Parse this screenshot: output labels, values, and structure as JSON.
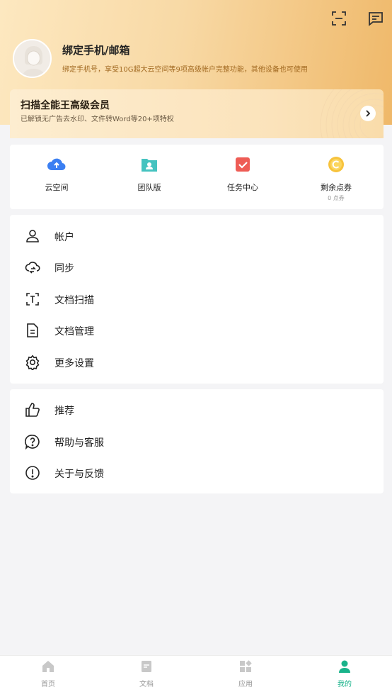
{
  "header": {
    "scan_icon": "scan-frame-icon",
    "message_icon": "message-icon",
    "user_title": "绑定手机/邮箱",
    "user_subtitle": "绑定手机号，享受10G超大云空间等9项高级帐户完整功能，其他设备也可使用"
  },
  "vip_banner": {
    "title": "扫描全能王高级会员",
    "subtitle": "已解锁无广告去水印、文件转Word等20+项特权"
  },
  "quick_actions": [
    {
      "label": "云空间",
      "icon": "cloud-upload-icon"
    },
    {
      "label": "团队版",
      "icon": "team-folder-icon"
    },
    {
      "label": "任务中心",
      "icon": "task-check-icon"
    },
    {
      "label": "剩余点券",
      "sub": "0 点券",
      "icon": "coupon-coin-icon"
    }
  ],
  "menu_group1": [
    {
      "label": "帐户",
      "icon": "user-icon"
    },
    {
      "label": "同步",
      "icon": "cloud-sync-icon"
    },
    {
      "label": "文档扫描",
      "icon": "scan-document-icon"
    },
    {
      "label": "文档管理",
      "icon": "document-icon"
    },
    {
      "label": "更多设置",
      "icon": "gear-icon"
    }
  ],
  "menu_group2": [
    {
      "label": "推荐",
      "icon": "thumbs-up-icon"
    },
    {
      "label": "帮助与客服",
      "icon": "help-icon"
    },
    {
      "label": "关于与反馈",
      "icon": "info-icon"
    }
  ],
  "tabbar": [
    {
      "label": "首页",
      "icon": "home-icon",
      "active": false
    },
    {
      "label": "文档",
      "icon": "document-tab-icon",
      "active": false
    },
    {
      "label": "应用",
      "icon": "apps-icon",
      "active": false
    },
    {
      "label": "我的",
      "icon": "person-icon",
      "active": true
    }
  ],
  "colors": {
    "accent": "#19b38a",
    "header_gold": "#efb869",
    "vip_text": "#a26a22"
  }
}
